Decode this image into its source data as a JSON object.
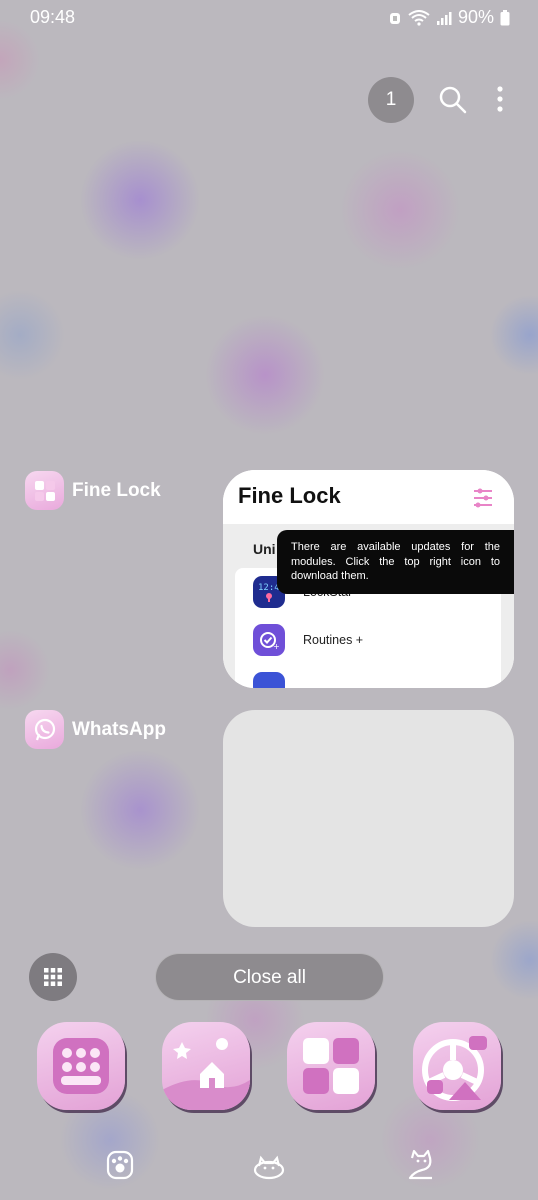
{
  "status": {
    "time": "09:48",
    "battery": "90%"
  },
  "recents": {
    "count_badge": "1",
    "close_all_label": "Close all",
    "apps": [
      {
        "name": "Fine Lock",
        "preview": {
          "title": "Fine Lock",
          "section_label": "Uni",
          "items": [
            "LockStar",
            "Routines +"
          ],
          "tooltip": "There are available updates for the modules. Click the top right icon to download them."
        }
      },
      {
        "name": "WhatsApp"
      }
    ]
  },
  "dock": {
    "icons": [
      "keyboard-app-icon",
      "gallery-app-icon",
      "finelock-app-icon",
      "chrome-app-icon"
    ]
  },
  "navbar": {
    "icons": [
      "recents-paw-icon",
      "home-cat-icon",
      "back-cat-icon"
    ]
  },
  "colors": {
    "accent_pink": "#e9a9dc",
    "tooltip_bg": "#0a0a0a",
    "badge_gray": "#8e8b8f"
  }
}
